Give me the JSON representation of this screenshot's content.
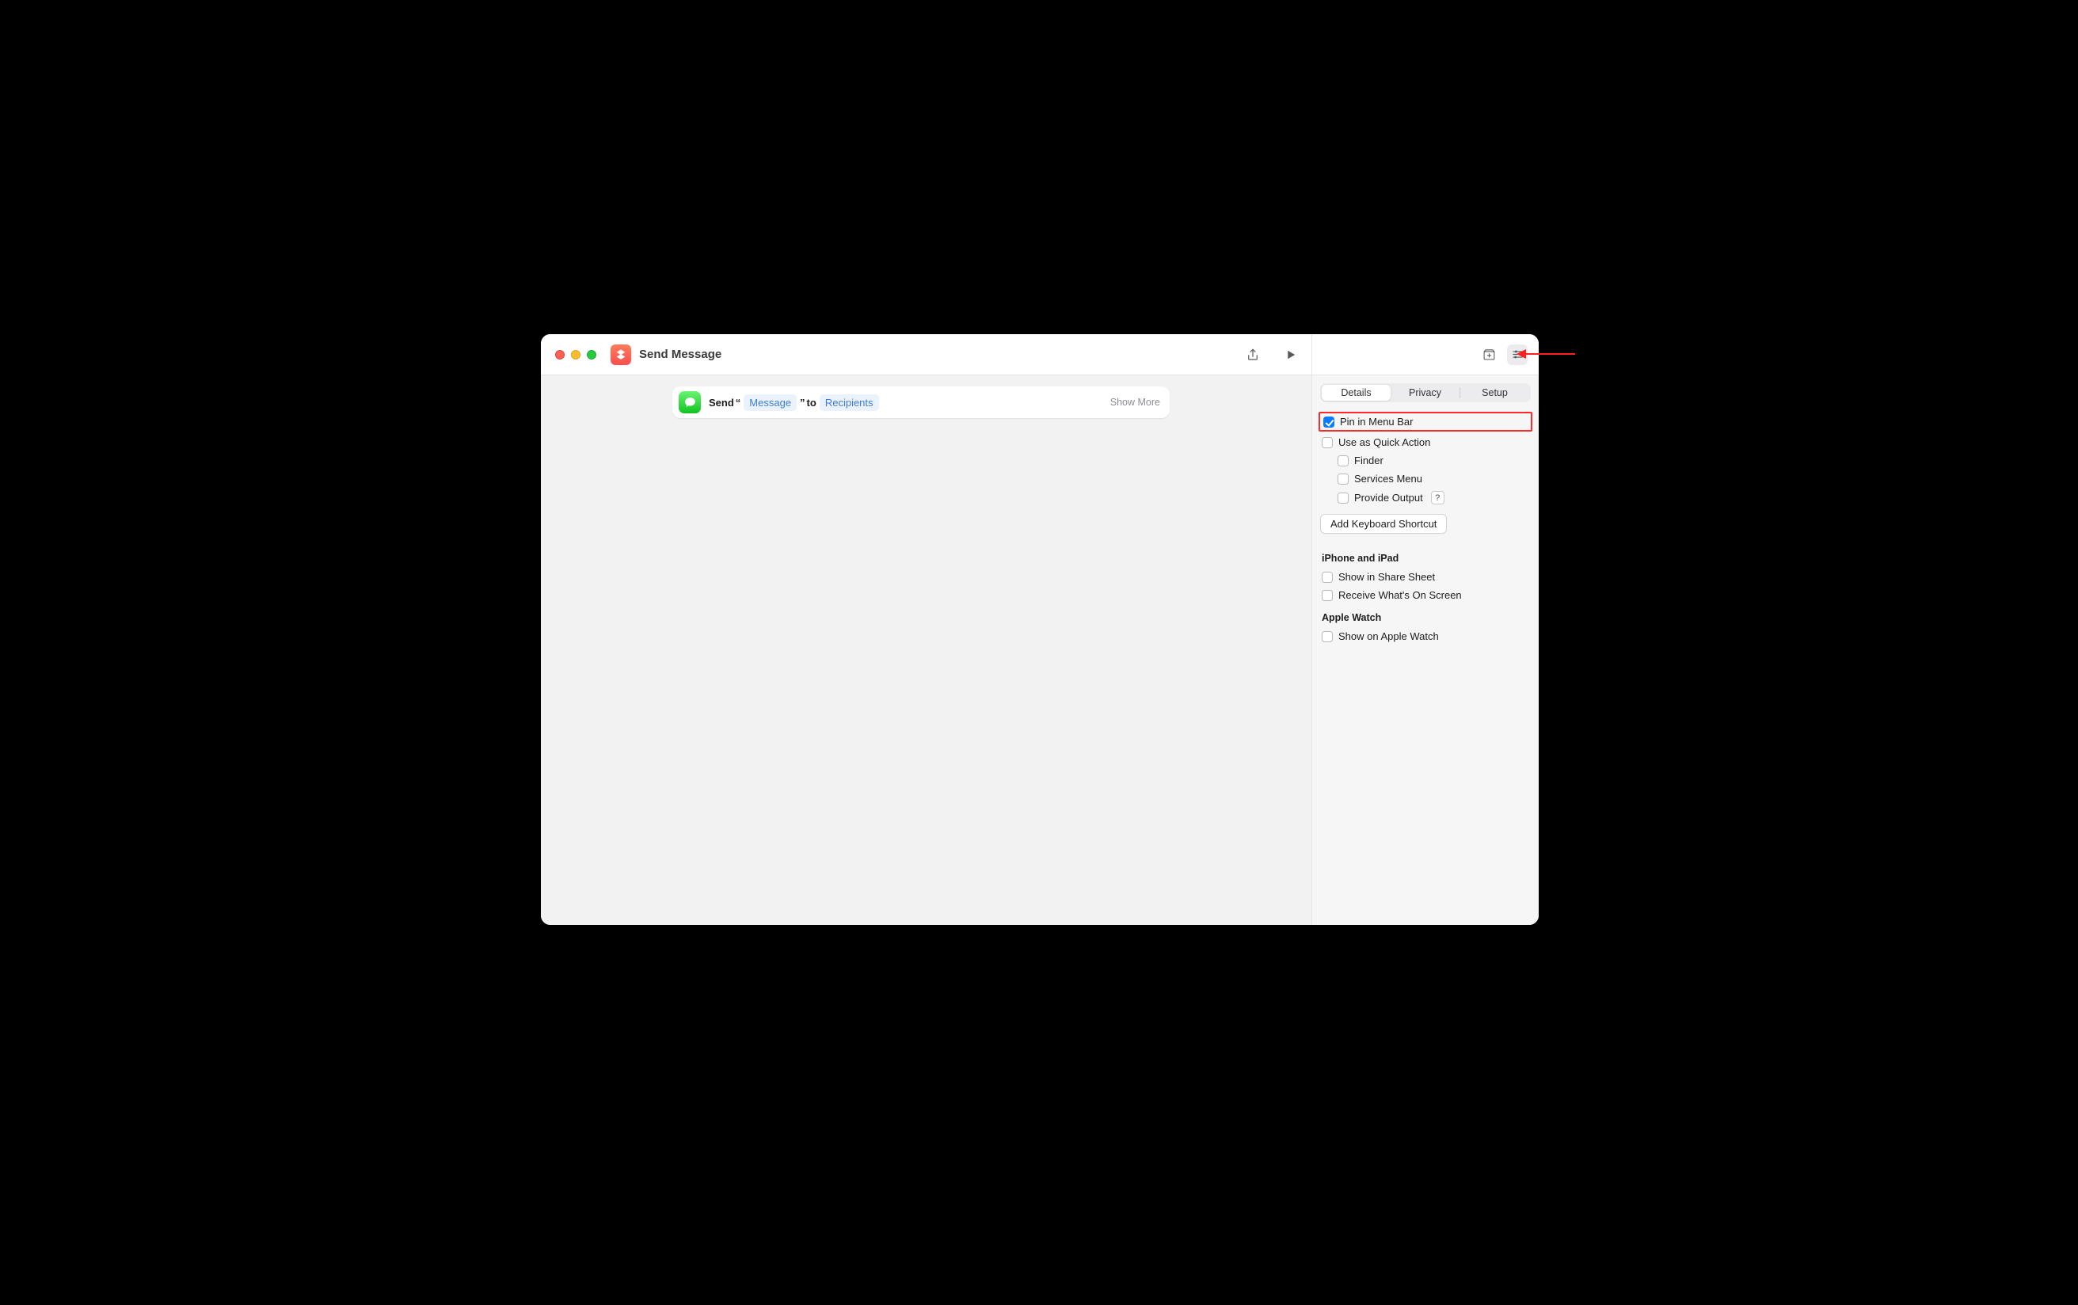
{
  "window": {
    "title": "Send Message"
  },
  "action": {
    "prefix": "Send",
    "open_quote": "“",
    "message_token": "Message",
    "close_quote": "”",
    "to_word": "to",
    "recipients_token": "Recipients",
    "show_more": "Show More"
  },
  "sidebar": {
    "tabs": [
      "Details",
      "Privacy",
      "Setup"
    ],
    "selected_tab": 0,
    "options": {
      "pin_menu_bar": {
        "label": "Pin in Menu Bar",
        "checked": true
      },
      "quick_action": {
        "label": "Use as Quick Action",
        "checked": false
      },
      "finder": {
        "label": "Finder",
        "checked": false
      },
      "services_menu": {
        "label": "Services Menu",
        "checked": false
      },
      "provide_output": {
        "label": "Provide Output",
        "checked": false,
        "help": "?"
      }
    },
    "add_shortcut_btn": "Add Keyboard Shortcut",
    "sections": {
      "iphone_ipad": {
        "title": "iPhone and iPad",
        "share_sheet": {
          "label": "Show in Share Sheet",
          "checked": false
        },
        "receive_screen": {
          "label": "Receive What's On Screen",
          "checked": false
        }
      },
      "apple_watch": {
        "title": "Apple Watch",
        "show_on_watch": {
          "label": "Show on Apple Watch",
          "checked": false
        }
      }
    }
  }
}
